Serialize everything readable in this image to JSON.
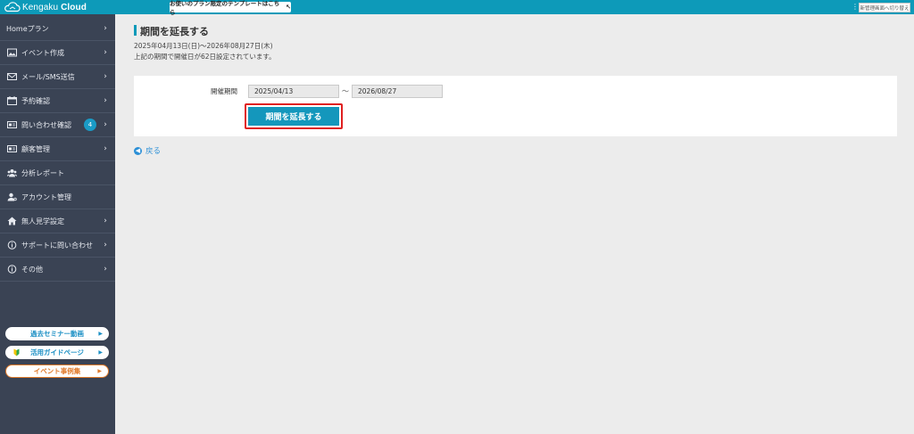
{
  "header": {
    "logo_text_light": "Kengaku",
    "logo_text_bold": "Cloud",
    "promo_label": "お使いのプラン限定のテンプレートはこちら",
    "promo_cursor": "↖",
    "menu_dots": "⋮",
    "switch_label": "新管理画面へ切り替え",
    "bar_color": "#0d9ab9"
  },
  "sidebar": {
    "items": [
      {
        "label": "Homeプラン",
        "icon": "none",
        "chevron": "›"
      },
      {
        "label": "イベント作成",
        "icon": "image-icon",
        "chevron": "›"
      },
      {
        "label": "メール/SMS送信",
        "icon": "mail-icon",
        "chevron": "›"
      },
      {
        "label": "予約確認",
        "icon": "calendar-icon",
        "chevron": "›"
      },
      {
        "label": "問い合わせ確認",
        "icon": "id-card-icon",
        "badge": "4",
        "chevron": "›"
      },
      {
        "label": "顧客管理",
        "icon": "id-card-icon",
        "chevron": "›"
      },
      {
        "label": "分析レポート",
        "icon": "users-icon"
      },
      {
        "label": "アカウント管理",
        "icon": "user-gear-icon"
      },
      {
        "label": "無人見学設定",
        "icon": "home-icon",
        "chevron": "›"
      },
      {
        "label": "サポートに問い合わせ",
        "icon": "info-icon",
        "chevron": "›"
      },
      {
        "label": "その他",
        "icon": "info-icon",
        "chevron": "›"
      }
    ],
    "buttons": {
      "seminar": "過去セミナー動画",
      "guide": "活用ガイドページ",
      "cases": "イベント事例集",
      "arrow": "▶"
    }
  },
  "main": {
    "title": "期間を延長する",
    "period": "2025年04月13日(日)～2026年08月27日(木)",
    "note": "上記の期間で開催日が62日設定されています。",
    "form": {
      "label": "開催期間",
      "start": "2025/04/13",
      "tilde": "～",
      "end": "2026/08/27",
      "submit": "期間を延長する"
    },
    "back": "戻る",
    "accent": "#1497bc",
    "highlight": "#e02020"
  }
}
